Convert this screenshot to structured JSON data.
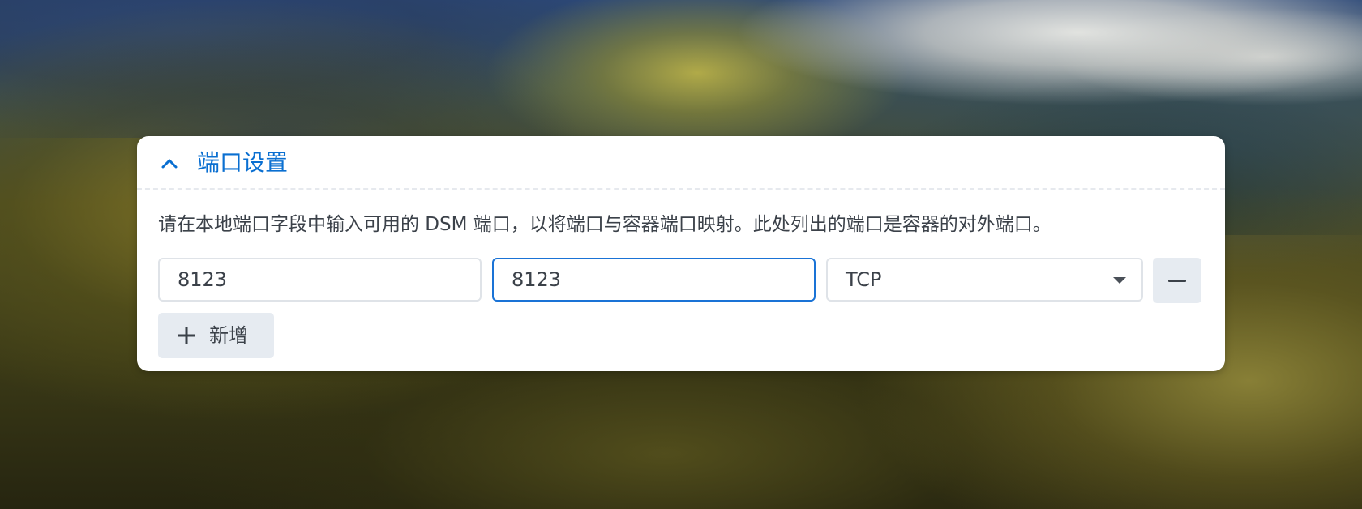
{
  "section": {
    "title": "端口设置",
    "expanded": true,
    "description": "请在本地端口字段中输入可用的 DSM 端口，以将端口与容器端口映射。此处列出的端口是容器的对外端口。"
  },
  "port_mapping": {
    "local_port": "8123",
    "container_port": "8123",
    "protocol": "TCP"
  },
  "buttons": {
    "add_label": "新增"
  },
  "colors": {
    "accent": "#0a6fd1",
    "focus_border": "#1a73d6",
    "button_bg": "#e6ebf1",
    "text": "#3b4149"
  }
}
